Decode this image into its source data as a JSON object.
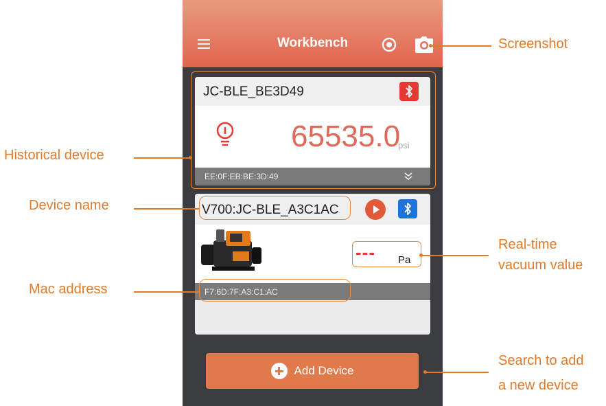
{
  "app": {
    "title": "Workbench",
    "icons": [
      "menu-icon",
      "record-icon",
      "camera-icon"
    ]
  },
  "historical_device": {
    "name": "JC-BLE_BE3D49",
    "value": "65535.0",
    "unit": "psi",
    "mac": "EE:0F:EB:BE:3D:49",
    "icons": [
      "bluetooth-icon",
      "bulb-icon",
      "chevron-down-icon"
    ]
  },
  "current_device": {
    "name": "V700:JC-BLE_A3C1AC",
    "value": "---",
    "unit": "Pa",
    "mac": "F7:6D:7F:A3:C1:AC",
    "icons": [
      "play-icon",
      "bluetooth-icon",
      "vacuum-pump-image"
    ]
  },
  "add_button": {
    "label": "Add Device",
    "icon": "plus-circle-icon"
  },
  "annotations": {
    "screenshot": "Screenshot",
    "historical_device": "Historical device",
    "device_name": "Device name",
    "realtime_line1": "Real-time",
    "realtime_line2": "vacuum value",
    "mac_address": "Mac address",
    "search_line1": "Search to add",
    "search_line2": "a new device"
  },
  "colors": {
    "accent": "#e07a2a",
    "appbar_top": "#e89a7e",
    "appbar_bottom": "#e0654e",
    "background": "#3a3c40",
    "value_red": "#e06a5a",
    "bluetooth_red": "#e53935",
    "bluetooth_blue": "#1e73d9"
  }
}
